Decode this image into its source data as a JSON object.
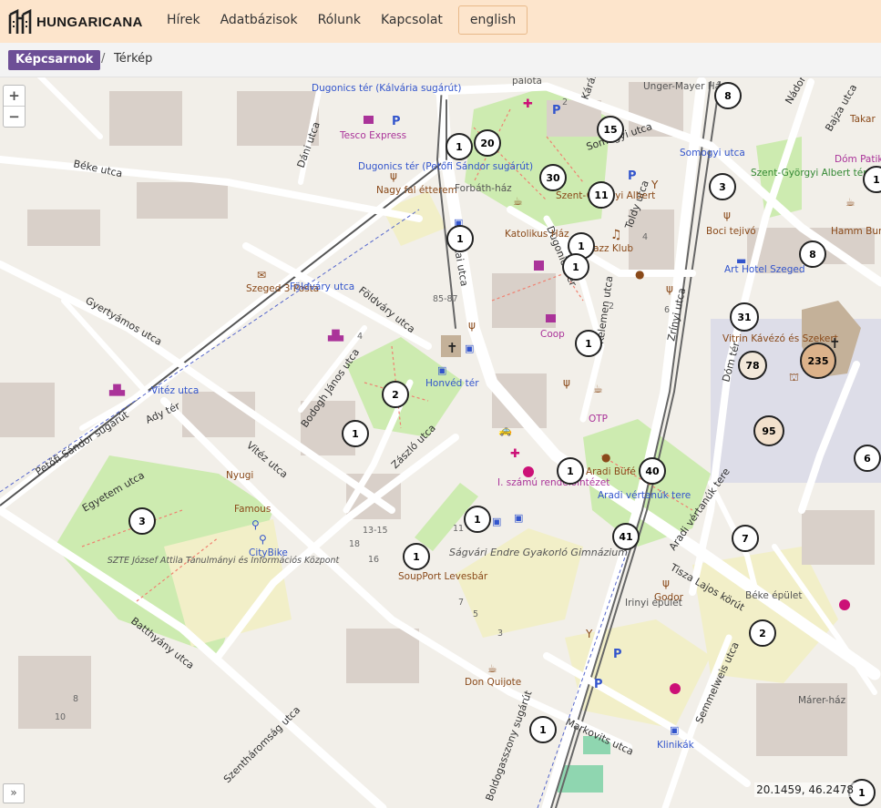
{
  "header": {
    "logo_text": "HUNGARICANA",
    "nav": [
      {
        "label": "Hírek"
      },
      {
        "label": "Adatbázisok"
      },
      {
        "label": "Rólunk"
      },
      {
        "label": "Kapcsolat"
      },
      {
        "label": "english"
      }
    ]
  },
  "breadcrumb": {
    "gallery": "Képcsarnok",
    "separator": "/",
    "current": "Térkép"
  },
  "map": {
    "zoom_in": "+",
    "zoom_out": "−",
    "expand": "»",
    "coordinates": "20.1459, 46.2478",
    "street_labels": [
      "Béke utca",
      "Dáni utca",
      "Gyertyámos utca",
      "Petőfi Sándor sugárút",
      "Vitéz utca",
      "Ady tér",
      "Egyetem utca",
      "Batthyány utca",
      "Szentháromság utca",
      "Zászló utca",
      "Bodogh János utca",
      "Földváry utca",
      "Tisza Lajos körút",
      "Somogyi utca",
      "Toldy utca",
      "Zrínyi utca",
      "Dóm tér",
      "Aradi vértanúk tere",
      "Markovits utca",
      "Semmelweis utca",
      "Kárász utca",
      "Nádor utca",
      "Bajza utca",
      "Dugonics tér",
      "Kelemen utca",
      "Boldogasszony sugárút",
      "Jókai utca"
    ],
    "poi_labels": [
      "Dugonics tér (Kálvária sugárút)",
      "Tesco Express",
      "Dugonics tér (Petőfi Sándor sugárút)",
      "Nagy fal étterem",
      "Forbáth-ház",
      "Szeged 3 Posta",
      "Földváry utca",
      "Katolikus Ház",
      "Szent-Györgyi Albert",
      "Jazz Klub",
      "Toldy utca",
      "Somogyi utca",
      "Szent-Györgyi Albert tér",
      "Boci tejivó",
      "Art Hotel Szeged",
      "Hamm Burger",
      "Unger-Mayer Ház",
      "palota",
      "Coop",
      "Honvéd tér",
      "Vitrin Kávézó és Szekert",
      "OTP",
      "Aradi Büfé",
      "Aradi vértanúk tere",
      "I. számú rendelőintézet",
      "Nyugi",
      "Famous",
      "CityBike",
      "SZTE József Attila Tanulmányi és Információs Központ",
      "SoupPort Levesbár",
      "Ságvári Endre Gyakorló Gimnázium",
      "Godor",
      "Irinyi épület",
      "Béke épület",
      "Don Quijote",
      "Klinikák",
      "Márer-ház",
      "Dóm Patika",
      "Takar",
      "Vitéz utca",
      "Dóm tér",
      "Szegedi Dóm"
    ],
    "house_numbers": [
      "85-87",
      "4",
      "13-15",
      "18",
      "16",
      "11",
      "7",
      "5",
      "3",
      "8",
      "10",
      "2",
      "6",
      "4",
      "2"
    ],
    "clusters": [
      "1",
      "20",
      "1",
      "30",
      "11",
      "15",
      "1",
      "1",
      "1",
      "1",
      "31",
      "78",
      "235",
      "95",
      "8",
      "8",
      "3",
      "1",
      "2",
      "1",
      "1",
      "1",
      "40",
      "41",
      "1",
      "7",
      "2",
      "3",
      "1",
      "1",
      "6",
      "1",
      "1",
      "1"
    ]
  }
}
